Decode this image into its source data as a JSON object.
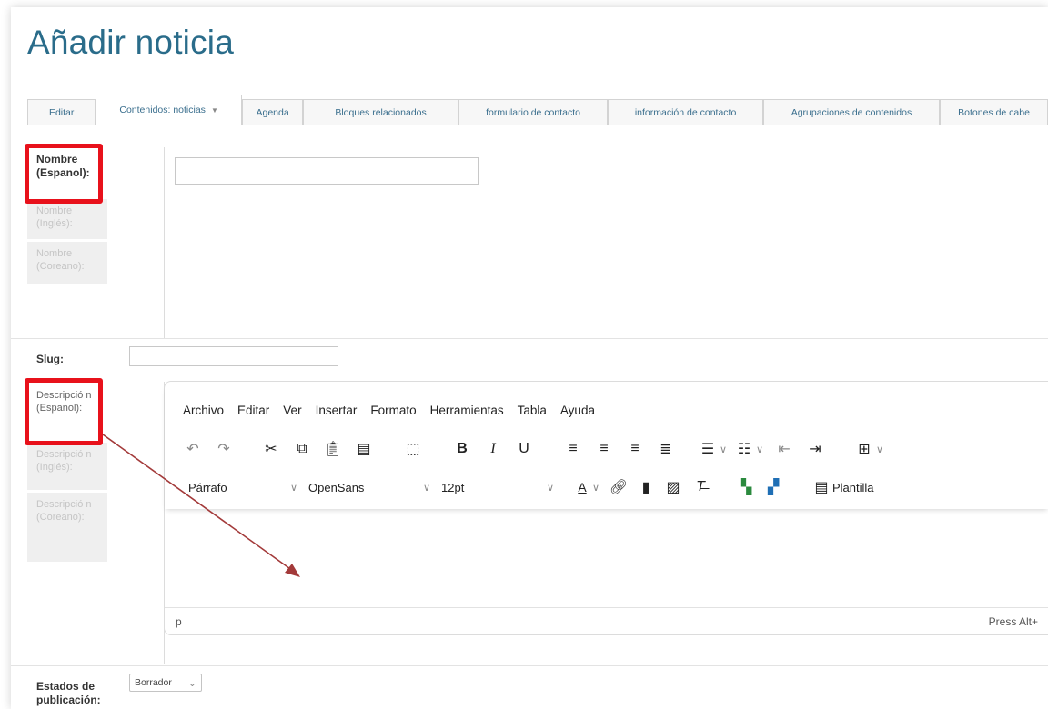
{
  "title": "Añadir noticia",
  "tabs": [
    {
      "label": "Editar",
      "active": false
    },
    {
      "label": "Contenidos: noticias",
      "active": true,
      "caret": "▼"
    },
    {
      "label": "Agenda",
      "active": false
    },
    {
      "label": "Bloques relacionados",
      "active": false
    },
    {
      "label": "formulario de contacto",
      "active": false
    },
    {
      "label": "información de contacto",
      "active": false
    },
    {
      "label": "Agrupaciones de contenidos",
      "active": false
    },
    {
      "label": "Botones de cabe",
      "active": false
    }
  ],
  "nombre": {
    "labels": [
      "Nombre (Espanol):",
      "Nombre (Inglés):",
      "Nombre (Coreano):"
    ],
    "value": ""
  },
  "slug": {
    "label": "Slug:",
    "value": ""
  },
  "descripcion": {
    "labels": [
      "Descripció n (Espanol):",
      "Descripció n (Inglés):",
      "Descripció n (Coreano):"
    ]
  },
  "editor": {
    "menu": [
      "Archivo",
      "Editar",
      "Ver",
      "Insertar",
      "Formato",
      "Herramientas",
      "Tabla",
      "Ayuda"
    ],
    "block_format": "Párrafo",
    "font_family": "OpenSans",
    "font_size": "12pt",
    "template_button": "Plantilla",
    "path": "p",
    "hint": "Press Alt+",
    "font_color_letter": "A"
  },
  "estados": {
    "label": "Estados de publicación:",
    "value": "Borrador"
  },
  "colors": {
    "accent": "#2a6c8a",
    "highlight": "#e8111b",
    "arrow": "#a33a3a"
  }
}
